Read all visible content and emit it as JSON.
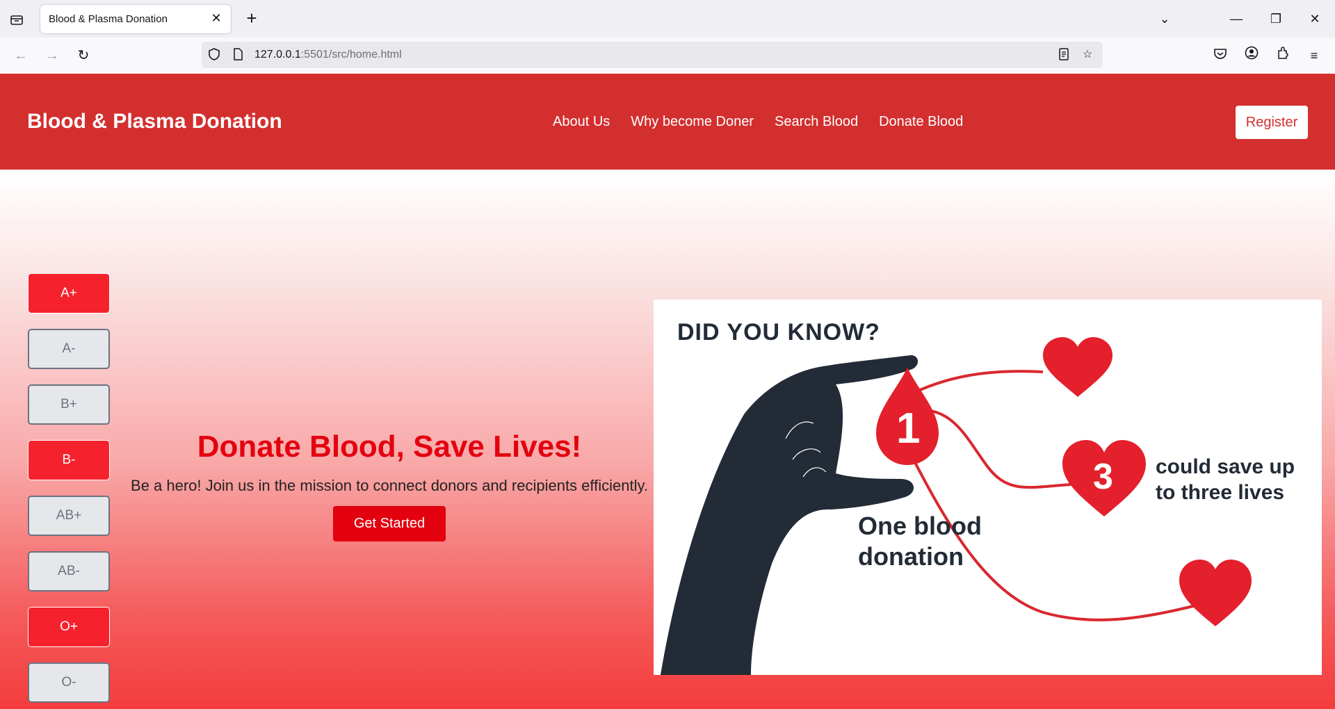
{
  "browser": {
    "tab_title": "Blood & Plasma Donation",
    "url_host": "127.0.0.1",
    "url_rest": ":5501/src/home.html"
  },
  "site": {
    "brand": "Blood & Plasma Donation",
    "menu": [
      "About Us",
      "Why become Doner",
      "Search Blood",
      "Donate Blood"
    ],
    "register_label": "Register"
  },
  "blood_types": [
    {
      "label": "A+",
      "active": true
    },
    {
      "label": "A-",
      "active": false
    },
    {
      "label": "B+",
      "active": false
    },
    {
      "label": "B-",
      "active": true
    },
    {
      "label": "AB+",
      "active": false
    },
    {
      "label": "AB-",
      "active": false
    },
    {
      "label": "O+",
      "active": true
    },
    {
      "label": "O-",
      "active": false
    }
  ],
  "hero": {
    "title": "Donate Blood, Save Lives!",
    "subtitle": "Be a hero! Join us in the mission to connect donors and recipients efficiently.",
    "cta_label": "Get Started"
  },
  "infographic": {
    "heading": "DID YOU KNOW?",
    "drop_number": "1",
    "heart_number": "3",
    "caption_left_1": "One blood",
    "caption_left_2": "donation",
    "caption_right_1": "could save up",
    "caption_right_2": "to three lives"
  },
  "colors": {
    "header_red": "#d32f2f",
    "accent_red": "#e3000f",
    "active_type": "#f5222d",
    "heart_red": "#e3202c",
    "hand_dark": "#222b36"
  }
}
